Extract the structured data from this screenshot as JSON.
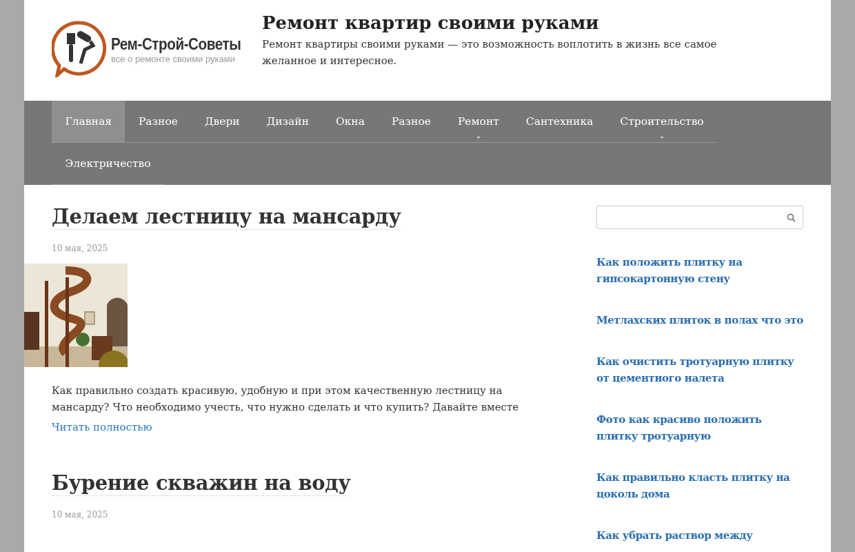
{
  "site": {
    "logo_title": "Рем-Строй-Советы",
    "logo_tagline": "все о ремонте своими руками",
    "title": "Ремонт квартир своими руками",
    "description": "Ремонт квартиры своими руками — это возможность воплотить в жизнь все самое желанное и интересное."
  },
  "menu": [
    {
      "label": "Главная",
      "selected": true,
      "has_submenu": false
    },
    {
      "label": "Разное",
      "selected": false,
      "has_submenu": false
    },
    {
      "label": "Двери",
      "selected": false,
      "has_submenu": false
    },
    {
      "label": "Дизайн",
      "selected": false,
      "has_submenu": false
    },
    {
      "label": "Окна",
      "selected": false,
      "has_submenu": false
    },
    {
      "label": "Разное",
      "selected": false,
      "has_submenu": false
    },
    {
      "label": "Ремонт",
      "selected": false,
      "has_submenu": true
    },
    {
      "label": "Сантехника",
      "selected": false,
      "has_submenu": false
    },
    {
      "label": "Строительство",
      "selected": false,
      "has_submenu": true
    },
    {
      "label": "Электричество",
      "selected": false,
      "has_submenu": false
    }
  ],
  "posts": [
    {
      "title": "Делаем лестницу на мансарду",
      "date": "10 мая, 2025",
      "excerpt": "Как правильно создать красивую, удобную и при этом качественную лестницу на мансарду? Что необходимо учесть, что нужно сделать и что купить? Давайте вместе",
      "read_more": "Читать полностью"
    },
    {
      "title": "Бурение скважин на воду",
      "date": "10 мая, 2025"
    }
  ],
  "sidebar_links": [
    "Как положить плитку на гипсокартонную стену",
    "Метлахских плиток в полах что это",
    "Как очистить тротуарную плитку от цементного налета",
    "Фото как красиво положить плитку тротуарную",
    "Как правильно класть плитку на цоколь дома",
    "Как убрать раствор между"
  ]
}
